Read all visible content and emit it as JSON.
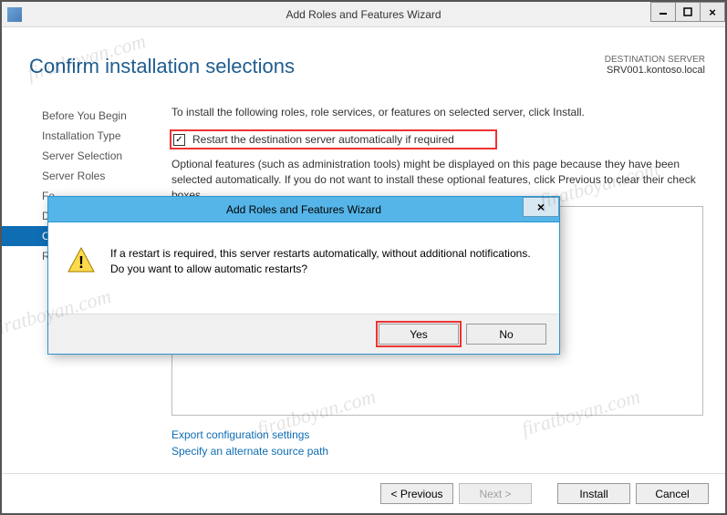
{
  "window_title": "Add Roles and Features Wizard",
  "page_title": "Confirm installation selections",
  "destination": {
    "label": "DESTINATION SERVER",
    "server": "SRV001.kontoso.local"
  },
  "steps": [
    {
      "label": "Before You Begin",
      "active": false
    },
    {
      "label": "Installation Type",
      "active": false
    },
    {
      "label": "Server Selection",
      "active": false
    },
    {
      "label": "Server Roles",
      "active": false
    },
    {
      "label": "Fe",
      "active": false
    },
    {
      "label": "D",
      "active": false
    },
    {
      "label": "Co",
      "active": true
    },
    {
      "label": "Re",
      "active": false
    }
  ],
  "instruction": "To install the following roles, role services, or features on selected server, click Install.",
  "restart": {
    "checked": true,
    "label": "Restart the destination server automatically if required"
  },
  "optional_text": "Optional features (such as administration tools) might be displayed on this page because they have been selected automatically. If you do not want to install these optional features, click Previous to clear their check boxes.",
  "links": {
    "export": "Export configuration settings",
    "alt_source": "Specify an alternate source path"
  },
  "buttons": {
    "previous": "< Previous",
    "next": "Next >",
    "install": "Install",
    "cancel": "Cancel"
  },
  "dialog": {
    "title": "Add Roles and Features Wizard",
    "message": "If a restart is required, this server restarts automatically, without additional notifications. Do you want to allow automatic restarts?",
    "yes": "Yes",
    "no": "No"
  },
  "watermark": "firatboyan.com"
}
